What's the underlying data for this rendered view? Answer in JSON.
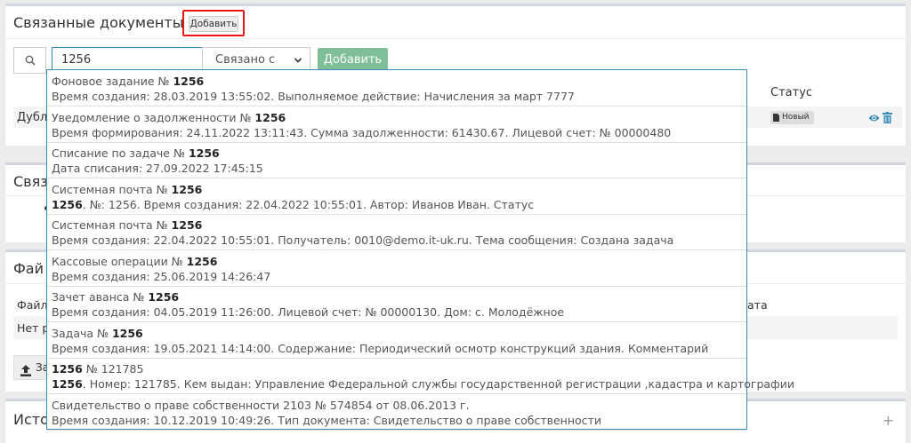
{
  "related_docs": {
    "title": "Связанные документы",
    "add_label": "Добавить",
    "search_value": "1256",
    "relation_select": "Связано с",
    "add_button": "Добавить",
    "status_header": "Статус",
    "row_trunc": "Дубл",
    "status_badge": "Новый"
  },
  "panel2": {
    "title_trunc": "Связ"
  },
  "files": {
    "title_trunc": "Фай",
    "col_trunc": "Файл",
    "date_trunc": "ата",
    "empty_trunc": "Нет р",
    "upload_trunc": "За"
  },
  "history": {
    "title_trunc": "Исто",
    "plus": "+"
  },
  "dropdown": [
    {
      "title": "Фоновое задание № ",
      "title_bold": "1256",
      "title_rest": "",
      "desc_bold": "",
      "desc": "Время создания: 28.03.2019 13:55:02. Выполняемое действие: Начисления за март 7777"
    },
    {
      "title": "Уведомление о задолженности № ",
      "title_bold": "1256",
      "title_rest": "",
      "desc_bold": "",
      "desc": "Время формирования: 24.11.2022 13:11:43. Сумма задолженности: 61430.67. Лицевой счет: № 00000480"
    },
    {
      "title": "Списание по задаче № ",
      "title_bold": "1256",
      "title_rest": "",
      "desc_bold": "",
      "desc": "Дата списания: 27.09.2022 17:45:15"
    },
    {
      "title": "Системная почта № ",
      "title_bold": "1256",
      "title_rest": "",
      "desc_bold": "1256",
      "desc": ". №: 1256. Время создания: 22.04.2022 10:55:01. Автор: Иванов Иван. Статус"
    },
    {
      "title": "Системная почта № ",
      "title_bold": "1256",
      "title_rest": "",
      "desc_bold": "",
      "desc": "Время создания: 22.04.2022 10:55:01. Получатель: 0010@demo.it-uk.ru. Тема сообщения: Создана задача"
    },
    {
      "title": "Кассовые операции № ",
      "title_bold": "1256",
      "title_rest": "",
      "desc_bold": "",
      "desc": "Время создания: 25.06.2019 14:26:47"
    },
    {
      "title": "Зачет аванса № ",
      "title_bold": "1256",
      "title_rest": "",
      "desc_bold": "",
      "desc": "Время создания: 04.05.2019 11:26:00. Лицевой счет: № 00000130. Дом: с. Молодёжное"
    },
    {
      "title": "Задача № ",
      "title_bold": "1256",
      "title_rest": "",
      "desc_bold": "",
      "desc": "Время создания: 19.05.2021 14:14:00. Содержание: Периодический осмотр конструкций здания. Комментарий"
    },
    {
      "title": "",
      "title_bold": "1256",
      "title_rest": " № 121785",
      "desc_bold": "1256",
      "desc": ". Номер: 121785. Кем выдан: Управление Федеральной службы государственной регистрации ,кадастра и картографии"
    },
    {
      "title": "Свидетельство о праве собственности 2103 № 574854 от 08.06.2013 г.",
      "title_bold": "",
      "title_rest": "",
      "desc_bold": "",
      "desc": "Время создания: 10.12.2019 10:49:26. Тип документа: Свидетельство о праве собственности"
    }
  ],
  "colors": {
    "accent": "#3c8dbc",
    "success": "#7fbf97",
    "highlight": "#e8141a"
  }
}
